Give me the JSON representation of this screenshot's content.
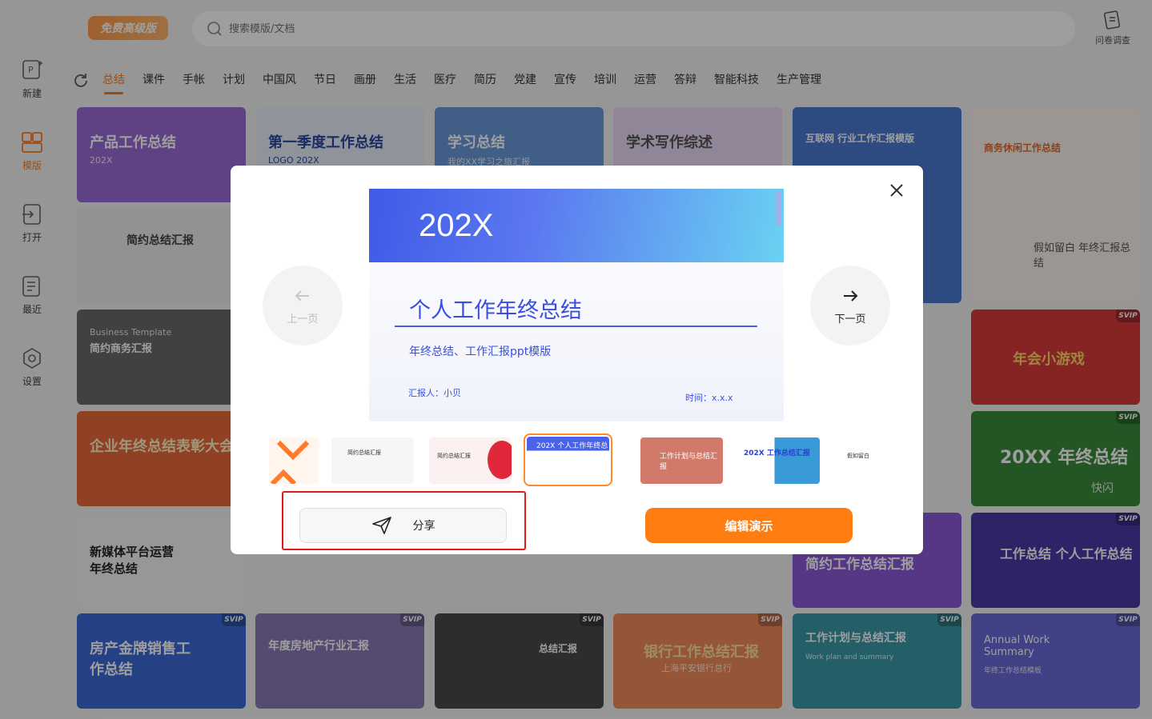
{
  "sidebar": {
    "items": [
      {
        "label": "新建",
        "icon": "new-file-icon"
      },
      {
        "label": "模版",
        "icon": "template-icon",
        "active": true
      },
      {
        "label": "打开",
        "icon": "open-icon"
      },
      {
        "label": "最近",
        "icon": "recent-icon"
      },
      {
        "label": "设置",
        "icon": "settings-icon"
      }
    ]
  },
  "header": {
    "badge": "免费高级版",
    "search_placeholder": "搜索模版/文档",
    "survey_label": "问卷调查"
  },
  "tabs": [
    "总结",
    "课件",
    "手帐",
    "计划",
    "中国风",
    "节日",
    "画册",
    "生活",
    "医疗",
    "简历",
    "党建",
    "宣传",
    "培训",
    "运营",
    "答辩",
    "智能科技",
    "生产管理"
  ],
  "active_tab": "总结",
  "grid_cards": [
    {
      "title": "产品工作总结",
      "sub": "202X",
      "color": "#9a6bd6"
    },
    {
      "title": "第一季度工作总结",
      "sub": "LOGO 202X",
      "color": "#e8eef8"
    },
    {
      "title": "学习总结",
      "sub": "我的XX学习之旅汇报",
      "color": "#6a9ad8"
    },
    {
      "title": "学术写作综述",
      "sub": "",
      "color": "#e8d8f4"
    },
    {
      "title": "互联网 行业工作汇报模版",
      "sub": "",
      "color": "#4a78d0"
    },
    {
      "title": "商务休闲工作总结",
      "sub": "",
      "color": "#fbf2ea"
    },
    {
      "title": "简约总结汇报",
      "sub": "",
      "color": "#ececec"
    },
    {
      "title": "假如留白 年终汇报总结",
      "sub": "",
      "color": "#f2f2f2"
    },
    {
      "title": "简约商务汇报",
      "sub": "Business Template",
      "color": "#6a6a6a"
    },
    {
      "title": "年会小游戏",
      "sub": "",
      "color": "#d83a3a"
    },
    {
      "title": "企业年终总结表彰大会",
      "sub": "",
      "color": "#e86a3a"
    },
    {
      "title": "20XX 年终总结",
      "sub": "快闪",
      "color": "#3a8a3a"
    },
    {
      "title": "新媒体平台运营年终总结",
      "sub": "",
      "color": "#f4f4f4"
    },
    {
      "title": "简约工作总结汇报",
      "sub": "",
      "color": "#8a5ad8"
    },
    {
      "title": "工作总结 个人工作总结",
      "sub": "",
      "color": "#4a3aa8"
    },
    {
      "title": "房产金牌销售工作总结",
      "sub": "",
      "color": "#3a6ad8"
    },
    {
      "title": "年度房地产行业汇报",
      "sub": "",
      "color": "#8a7ab8"
    },
    {
      "title": "总结汇报",
      "sub": "",
      "color": "#4a4a4a"
    },
    {
      "title": "银行工作总结汇报",
      "sub": "上海平安银行总行",
      "color": "#f08a5a"
    },
    {
      "title": "工作计划与总结汇报",
      "sub": "Work plan and summary",
      "color": "#3a9aa8"
    },
    {
      "title": "Annual Work Summary",
      "sub": "年终工作总结模板",
      "color": "#6a6ad8"
    }
  ],
  "svip_label": "SVIP",
  "modal": {
    "preview": {
      "year": "202X",
      "title": "个人工作年终总结",
      "subtitle": "年终总结、工作汇报ppt模版",
      "reporter": "汇报人：小贝",
      "time": "时间：x.x.x"
    },
    "prev_label": "上一页",
    "next_label": "下一页",
    "thumbnails": [
      {
        "label": "",
        "color": "#fff5ec"
      },
      {
        "label": "简约总结汇报",
        "color": "#f6f6f6"
      },
      {
        "label": "简约总结汇报",
        "color": "#fbeff0"
      },
      {
        "label": "202X 个人工作年终总结",
        "color": "#5b78f0",
        "selected": true
      },
      {
        "label": "工作计划与总结汇报",
        "color": "#d27a6a"
      },
      {
        "label": "202X 工作总结汇报",
        "color": "#2b3fd0"
      },
      {
        "label": "假如留白",
        "color": "#ffffff"
      }
    ],
    "share_label": "分享",
    "edit_label": "编辑演示"
  }
}
